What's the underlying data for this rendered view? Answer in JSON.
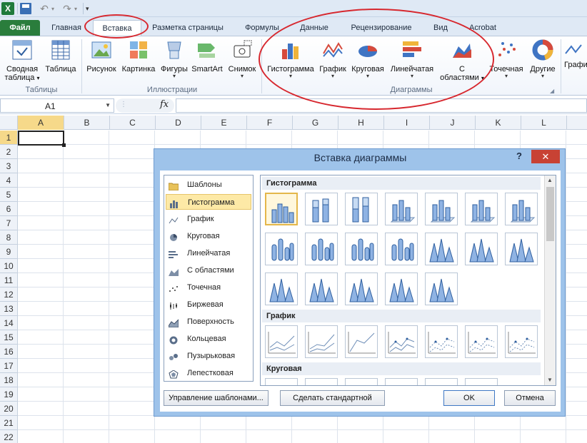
{
  "app": {
    "logo_letter": "X",
    "undo_icon": "undo-icon",
    "redo_icon": "redo-icon"
  },
  "tabs": [
    {
      "label": "Файл"
    },
    {
      "label": "Главная"
    },
    {
      "label": "Вставка"
    },
    {
      "label": "Разметка страницы"
    },
    {
      "label": "Формулы"
    },
    {
      "label": "Данные"
    },
    {
      "label": "Рецензирование"
    },
    {
      "label": "Вид"
    },
    {
      "label": "Acrobat"
    }
  ],
  "ribbon": {
    "tables": {
      "label": "Таблицы",
      "pivot": {
        "line1": "Сводная",
        "line2": "таблица",
        "arrow": "▾"
      },
      "table": {
        "label": "Таблица"
      }
    },
    "illustrations": {
      "label": "Иллюстрации",
      "picture": "Рисунок",
      "clipart": "Картинка",
      "shapes": "Фигуры",
      "smartart": "SmartArt",
      "screenshot": "Снимок"
    },
    "charts": {
      "label": "Диаграммы",
      "histogram": "Гистограмма",
      "line": "График",
      "pie": "Круговая",
      "bar": "Линейчатая",
      "area_line1": "С",
      "area_line2": "областями",
      "scatter": "Точечная",
      "other": "Другие",
      "next_partial": "Графи"
    }
  },
  "formula_bar": {
    "name_box": "A1",
    "fx": "fx",
    "value": ""
  },
  "sheet": {
    "columns": [
      "A",
      "B",
      "C",
      "D",
      "E",
      "F",
      "G",
      "H",
      "I",
      "J",
      "K",
      "L"
    ],
    "rows": [
      "1",
      "2",
      "3",
      "4",
      "5",
      "6",
      "7",
      "8",
      "9",
      "10",
      "11",
      "12",
      "13",
      "14",
      "15",
      "16",
      "17",
      "18",
      "19",
      "20",
      "21",
      "22"
    ],
    "active_cell": "A1"
  },
  "dialog": {
    "title": "Вставка диаграммы",
    "help": "?",
    "close": "✕",
    "categories": [
      {
        "label": "Шаблоны",
        "icon": "folder-icon"
      },
      {
        "label": "Гистограмма",
        "icon": "column-chart-icon",
        "selected": true
      },
      {
        "label": "График",
        "icon": "line-chart-icon"
      },
      {
        "label": "Круговая",
        "icon": "pie-chart-icon"
      },
      {
        "label": "Линейчатая",
        "icon": "bar-chart-icon"
      },
      {
        "label": "С областями",
        "icon": "area-chart-icon"
      },
      {
        "label": "Точечная",
        "icon": "scatter-chart-icon"
      },
      {
        "label": "Биржевая",
        "icon": "stock-chart-icon"
      },
      {
        "label": "Поверхность",
        "icon": "surface-chart-icon"
      },
      {
        "label": "Кольцевая",
        "icon": "doughnut-chart-icon"
      },
      {
        "label": "Пузырьковая",
        "icon": "bubble-chart-icon"
      },
      {
        "label": "Лепестковая",
        "icon": "radar-chart-icon"
      }
    ],
    "sections": {
      "histogram": "Гистограмма",
      "line": "График",
      "pie": "Круговая"
    },
    "buttons": {
      "manage": "Управление шаблонами...",
      "set_default": "Сделать стандартной",
      "ok": "OK",
      "cancel": "Отмена"
    }
  },
  "colors": {
    "annotation": "#d7282f",
    "file_tab": "#2a7d3c",
    "selection": "#fde9a6"
  }
}
